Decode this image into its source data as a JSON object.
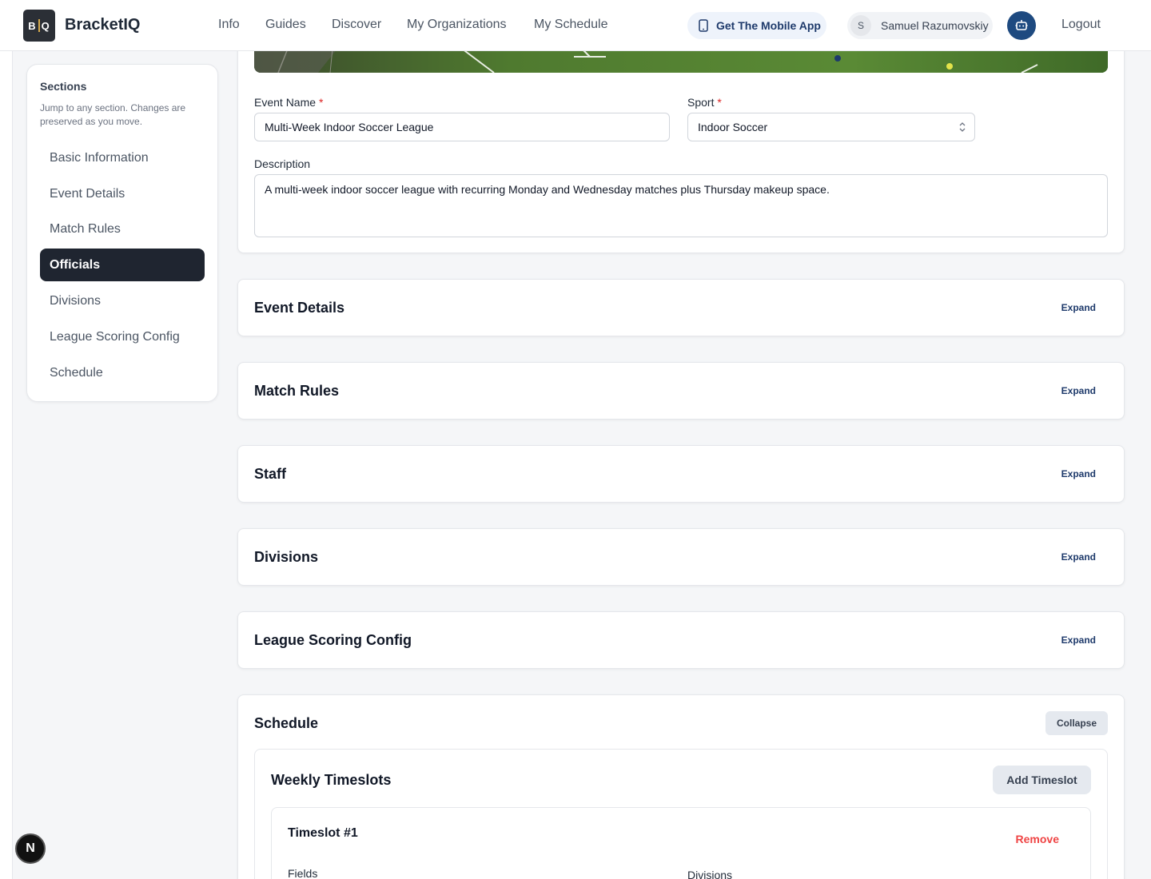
{
  "brand": {
    "logo_text": "BIQ",
    "name": "BracketIQ"
  },
  "nav": [
    {
      "label": "Info"
    },
    {
      "label": "Guides"
    },
    {
      "label": "Discover"
    },
    {
      "label": "My Organizations"
    },
    {
      "label": "My Schedule"
    }
  ],
  "header": {
    "mobile_app_label": "Get The Mobile App",
    "user_initial": "S",
    "user_name": "Samuel Razumovskiy",
    "logout_label": "Logout"
  },
  "sidebar": {
    "title": "Sections",
    "description": "Jump to any section. Changes are preserved as you move.",
    "items": [
      {
        "label": "Basic Information",
        "active": false
      },
      {
        "label": "Event Details",
        "active": false
      },
      {
        "label": "Match Rules",
        "active": false
      },
      {
        "label": "Officials",
        "active": true
      },
      {
        "label": "Divisions",
        "active": false
      },
      {
        "label": "League Scoring Config",
        "active": false
      },
      {
        "label": "Schedule",
        "active": false
      }
    ]
  },
  "basic_info": {
    "event_name_label": "Event Name",
    "event_name_value": "Multi-Week Indoor Soccer League",
    "sport_label": "Sport",
    "sport_value": "Indoor Soccer",
    "required_mark": "*",
    "description_label": "Description",
    "description_value": "A multi-week indoor soccer league with recurring Monday and Wednesday matches plus Thursday makeup space."
  },
  "sections": [
    {
      "title": "Event Details",
      "action": "Expand"
    },
    {
      "title": "Match Rules",
      "action": "Expand"
    },
    {
      "title": "Staff",
      "action": "Expand"
    },
    {
      "title": "Divisions",
      "action": "Expand"
    },
    {
      "title": "League Scoring Config",
      "action": "Expand"
    }
  ],
  "schedule": {
    "title": "Schedule",
    "collapse_label": "Collapse",
    "weekly_title": "Weekly Timeslots",
    "add_label": "Add Timeslot",
    "timeslot_title": "Timeslot #1",
    "remove_label": "Remove",
    "fields_label": "Fields",
    "divisions_label": "Divisions"
  },
  "dev_badge": {
    "label": "N"
  },
  "colors": {
    "primary": "#1e3a6b",
    "active_bg": "#1f2530",
    "danger": "#ef4444"
  }
}
